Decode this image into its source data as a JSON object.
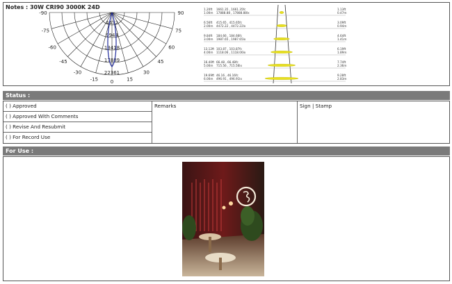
{
  "notes": {
    "title": "Notes : 30W CRI90 3000K 24D",
    "polar_labels": [
      "-90",
      "-75",
      "-60",
      "-45",
      "-30",
      "-15",
      "0",
      "15",
      "30",
      "45",
      "60",
      "75",
      "90"
    ],
    "polar_values": [
      "4472",
      "9944",
      "13418",
      "17889",
      "22361"
    ],
    "cone_rows": [
      {
        "left_top": "1.20ft",
        "left_bot": "1.00m",
        "mid_top": "1661.35 , 1661.35fc",
        "mid_bot": "17888.88 , 17888.88lx",
        "right_top": "1.13ft",
        "right_bot": "0.47m"
      },
      {
        "left_top": "6.56ft",
        "left_bot": "2.00m",
        "mid_top": "415.65 , 415.65fc",
        "mid_bot": "4472.22 , 4472.22lx",
        "right_top": "3.09ft",
        "right_bot": "0.94m"
      },
      {
        "left_top": "9.84ft",
        "left_bot": "3.00m",
        "mid_top": "184.66 , 184.66fc",
        "mid_bot": "1987.65 , 1987.65lx",
        "right_top": "4.64ft",
        "right_bot": "1.41m"
      },
      {
        "left_top": "13.12ft",
        "left_bot": "4.00m",
        "mid_top": "103.87 , 103.87fc",
        "mid_bot": "1118.06 , 1118.06lx",
        "right_top": "6.19ft",
        "right_bot": "1.89m"
      },
      {
        "left_top": "16.40ft",
        "left_bot": "5.00m",
        "mid_top": "66.48 , 66.48fc",
        "mid_bot": "715.56 , 715.56lx",
        "right_top": "7.74ft",
        "right_bot": "2.36m"
      },
      {
        "left_top": "19.69ft",
        "left_bot": "6.00m",
        "mid_top": "46.16 , 46.16fc",
        "mid_bot": "496.91 , 496.91lx",
        "right_top": "9.28ft",
        "right_bot": "2.83m"
      }
    ]
  },
  "status": {
    "header": "Status :",
    "options": [
      "(     ) Approved",
      "(     ) Approved With Comments",
      "(     ) Revise And Resubmit",
      "(     ) For Record Use"
    ],
    "remarks_label": "Remarks",
    "sign_label": "Sign | Stamp"
  },
  "for_use": {
    "header": "For  Use :"
  },
  "colors": {
    "bar": "#7a7a7a",
    "curve": "#1f2a9c",
    "ellipse_fill": "#e8e020"
  }
}
